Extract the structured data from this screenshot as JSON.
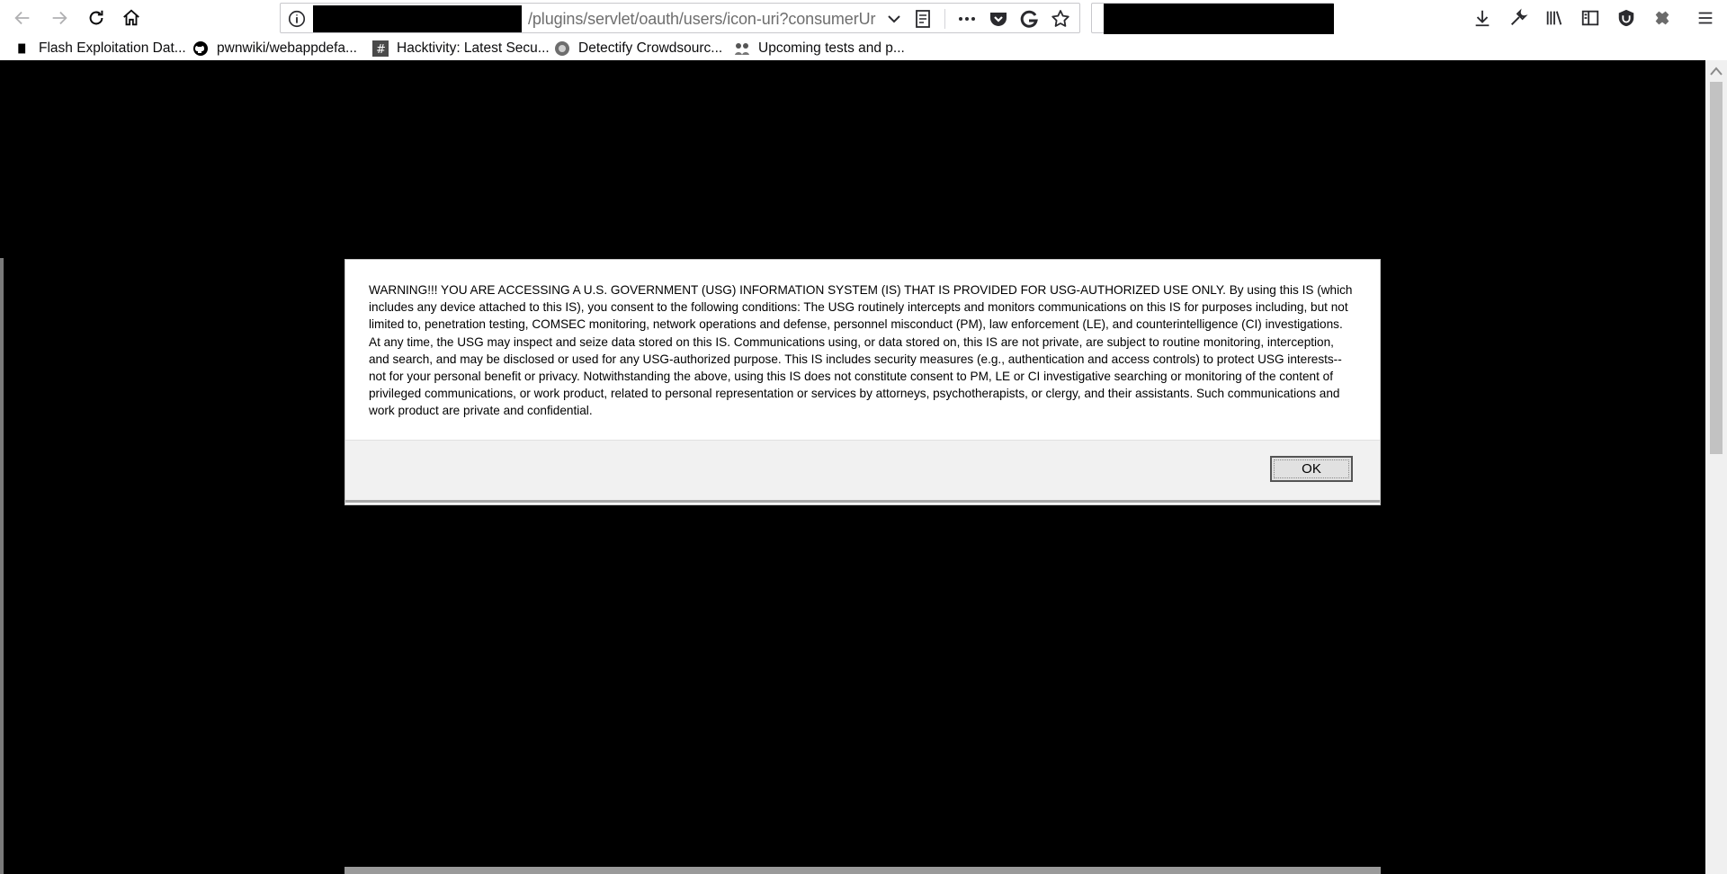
{
  "browser": {
    "url_visible_text": "/plugins/servlet/oauth/users/icon-uri?consumerUr",
    "nav": {
      "back": "back-arrow-icon",
      "forward": "forward-arrow-icon",
      "reload": "reload-icon",
      "home": "home-icon"
    }
  },
  "bookmarks": [
    {
      "label": "Flash Exploitation Dat...",
      "icon": "bookmark-black-icon"
    },
    {
      "label": "pwnwiki/webappdefa...",
      "icon": "github-icon"
    },
    {
      "label": "Hacktivity: Latest Secu...",
      "icon": "hash-icon"
    },
    {
      "label": "Detectify Crowdsourc...",
      "icon": "detectify-icon"
    },
    {
      "label": "Upcoming tests and p...",
      "icon": "tests-icon"
    }
  ],
  "dialog": {
    "message": "WARNING!!! YOU ARE ACCESSING A U.S. GOVERNMENT (USG) INFORMATION SYSTEM (IS) THAT IS PROVIDED FOR USG-AUTHORIZED USE ONLY. By using this IS (which includes any device attached to this IS), you consent to the following conditions: The USG routinely intercepts and monitors communications on this IS for purposes including, but not limited to, penetration testing, COMSEC monitoring, network operations and defense, personnel misconduct (PM), law enforcement (LE), and counterintelligence (CI) investigations. At any time, the USG may inspect and seize data stored on this IS. Communications using, or data stored on, this IS are not private, are subject to routine monitoring, interception, and search, and may be disclosed or used for any USG-authorized purpose. This IS includes security measures (e.g., authentication and access controls) to protect USG interests--not for your  personal benefit or privacy. Notwithstanding the above, using this IS does not constitute consent to PM, LE or CI investigative searching or monitoring of the content of privileged communications, or work product, related to personal representation or services by attorneys, psychotherapists, or clergy, and their assistants. Such communications and work product are private and confidential.",
    "ok_label": "OK"
  },
  "colors": {
    "page_background": "#000000",
    "dialog_background": "#ffffff",
    "footer_background": "#f1f1f1"
  }
}
